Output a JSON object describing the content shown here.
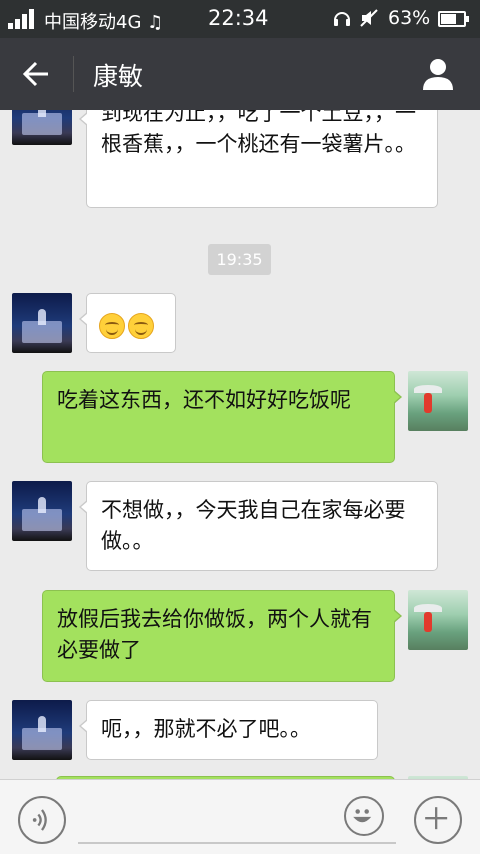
{
  "status_bar": {
    "carrier": "中国移动4G",
    "time": "22:34",
    "battery": "63%",
    "battery_level": 0.63,
    "icons": [
      "signal-icon",
      "music-note-icon",
      "headphone-icon",
      "mute-icon",
      "battery-icon"
    ]
  },
  "nav": {
    "title": "康敏",
    "icons": [
      "back-arrow-icon",
      "profile-icon"
    ]
  },
  "messages": [
    {
      "side": "in",
      "text": "到现在为止，，吃了一个土豆，，一根香蕉，，一个桃还有一袋薯片。。"
    },
    {
      "type": "time",
      "text": "19:35"
    },
    {
      "side": "in",
      "emoji_count": 2,
      "emoji": "smile-emoji-icon"
    },
    {
      "side": "out",
      "text": "吃着这东西，还不如好好吃饭呢"
    },
    {
      "side": "in",
      "text": "不想做，，今天我自己在家每必要做。。"
    },
    {
      "side": "out",
      "text": "放假后我去给你做饭，两个人就有必要做了"
    },
    {
      "side": "in",
      "text": "呃，，那就不必了吧。。"
    }
  ],
  "input_bar": {
    "icons": [
      "voice-icon",
      "emoji-icon",
      "plus-icon"
    ]
  },
  "colors": {
    "status_bar_bg": "#2e3132",
    "nav_bg": "#393a3f",
    "chat_bg": "#ebebeb",
    "outgoing_bubble": "#a3e15e",
    "incoming_bubble": "#ffffff"
  }
}
